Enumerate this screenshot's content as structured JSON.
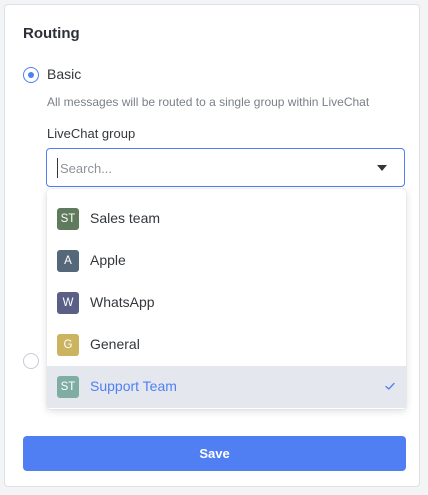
{
  "routing": {
    "title": "Routing",
    "basic_label": "Basic",
    "basic_description": "All messages will be routed to a single group within LiveChat",
    "group_label": "LiveChat group",
    "search_placeholder": "Search...",
    "selected_option": "Support Team"
  },
  "dropdown": {
    "options": [
      {
        "initials": "ST",
        "label": "Sales team",
        "color": "#5f7a5c",
        "selected": false
      },
      {
        "initials": "A",
        "label": "Apple",
        "color": "#55687a",
        "selected": false
      },
      {
        "initials": "W",
        "label": "WhatsApp",
        "color": "#5a5f86",
        "selected": false
      },
      {
        "initials": "G",
        "label": "General",
        "color": "#cbb35f",
        "selected": false
      },
      {
        "initials": "ST",
        "label": "Support Team",
        "color": "#7fada4",
        "selected": true
      }
    ]
  },
  "actions": {
    "save_label": "Save"
  },
  "colors": {
    "accent": "#4f7ff3",
    "selected_row": "#e4e8ee"
  }
}
